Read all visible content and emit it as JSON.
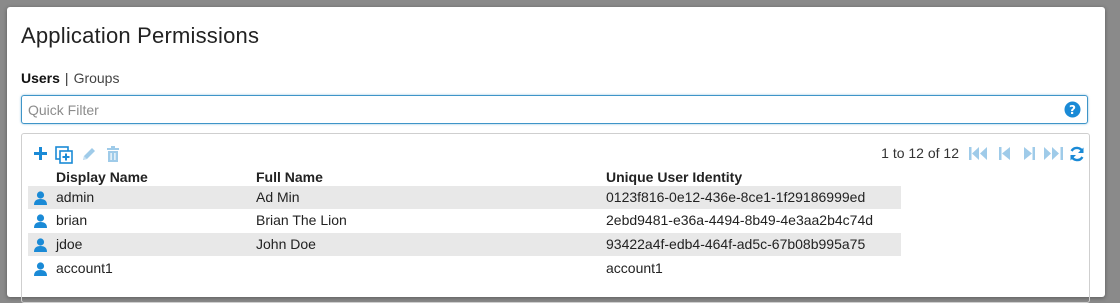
{
  "page": {
    "title": "Application Permissions"
  },
  "tabs": {
    "active": "Users",
    "separator": "|",
    "other": "Groups"
  },
  "filter": {
    "placeholder": "Quick Filter",
    "value": ""
  },
  "toolbar": {
    "icons": [
      "add-icon",
      "add-copy-icon",
      "edit-icon",
      "delete-icon"
    ]
  },
  "pager": {
    "text": "1 to 12 of 12",
    "icons": [
      "first-page-icon",
      "previous-page-icon",
      "next-page-icon",
      "last-page-icon",
      "refresh-icon"
    ]
  },
  "table": {
    "columns": {
      "display_name": "Display Name",
      "full_name": "Full Name",
      "identity": "Unique User Identity"
    },
    "rows": [
      {
        "display_name": "admin",
        "full_name": "Ad Min",
        "identity": "0123f816-0e12-436e-8ce1-1f29186999ed"
      },
      {
        "display_name": "brian",
        "full_name": "Brian The Lion",
        "identity": "2ebd9481-e36a-4494-8b49-4e3aa2b4c74d"
      },
      {
        "display_name": "jdoe",
        "full_name": "John Doe",
        "identity": "93422a4f-edb4-464f-ad5c-67b08b995a75"
      },
      {
        "display_name": "account1",
        "full_name": "",
        "identity": "account1"
      }
    ]
  },
  "colors": {
    "accent": "#1a8ad6",
    "disabled": "#9fcbe9",
    "row_alt": "#e8e8e8"
  }
}
